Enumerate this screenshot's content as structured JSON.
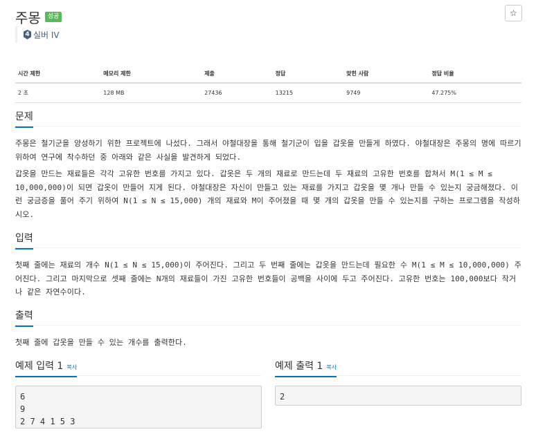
{
  "problem": {
    "title": "주몽",
    "badge": "성공",
    "star": "☆",
    "tier_num": "4",
    "tier_label": "실버 IV"
  },
  "stats": {
    "headers": [
      "시간 제한",
      "메모리 제한",
      "제출",
      "정답",
      "맞힌 사람",
      "정답 비율"
    ],
    "values": [
      "2 초",
      "128 MB",
      "27436",
      "13215",
      "9749",
      "47.275%"
    ]
  },
  "sections": {
    "problem_title": "문제",
    "problem_p1": "주몽은 철기군을 양성하기 위한 프로젝트에 나섰다. 그래서 야철대장을 통해 철기군이 입을 갑옷을 만들게 하였다. 야철대장은 주몽의 명에 따르기 위하여 연구에 착수하던 중 아래와 같은 사실을 발견하게 되었다.",
    "problem_p2": "갑옷을 만드는 재료들은 각각 고유한 번호를 가지고 있다. 갑옷은 두 개의 재료로 만드는데 두 재료의 고유한 번호를 합쳐서 M(1 ≤ M ≤ 10,000,000)이 되면 갑옷이 만들어 지게 된다. 야철대장은 자신이 만들고 있는 재료를 가지고 갑옷을 몇 개나 만들 수 있는지 궁금해졌다. 이런 궁금증을 풀어 주기 위하여 N(1 ≤ N ≤ 15,000) 개의 재료와 M이 주어졌을 때 몇 개의 갑옷을 만들 수 있는지를 구하는 프로그램을 작성하시오.",
    "input_title": "입력",
    "input_p": "첫째 줄에는 재료의 개수 N(1 ≤ N ≤ 15,000)이 주어진다. 그리고 두 번째 줄에는 갑옷을 만드는데 필요한 수 M(1 ≤ M ≤ 10,000,000) 주어진다. 그리고 마지막으로 셋째 줄에는 N개의 재료들이 가진 고유한 번호들이 공백을 사이에 두고 주어진다. 고유한 번호는 100,000보다 작거나 같은 자연수이다.",
    "output_title": "출력",
    "output_p": "첫째 줄에 갑옷을 만들 수 있는 개수를 출력한다."
  },
  "examples": {
    "input_title": "예제 입력 1",
    "output_title": "예제 출력 1",
    "copy_label": "복사",
    "input_text": "6\n9\n2 7 4 1 5 3",
    "output_text": "2"
  }
}
